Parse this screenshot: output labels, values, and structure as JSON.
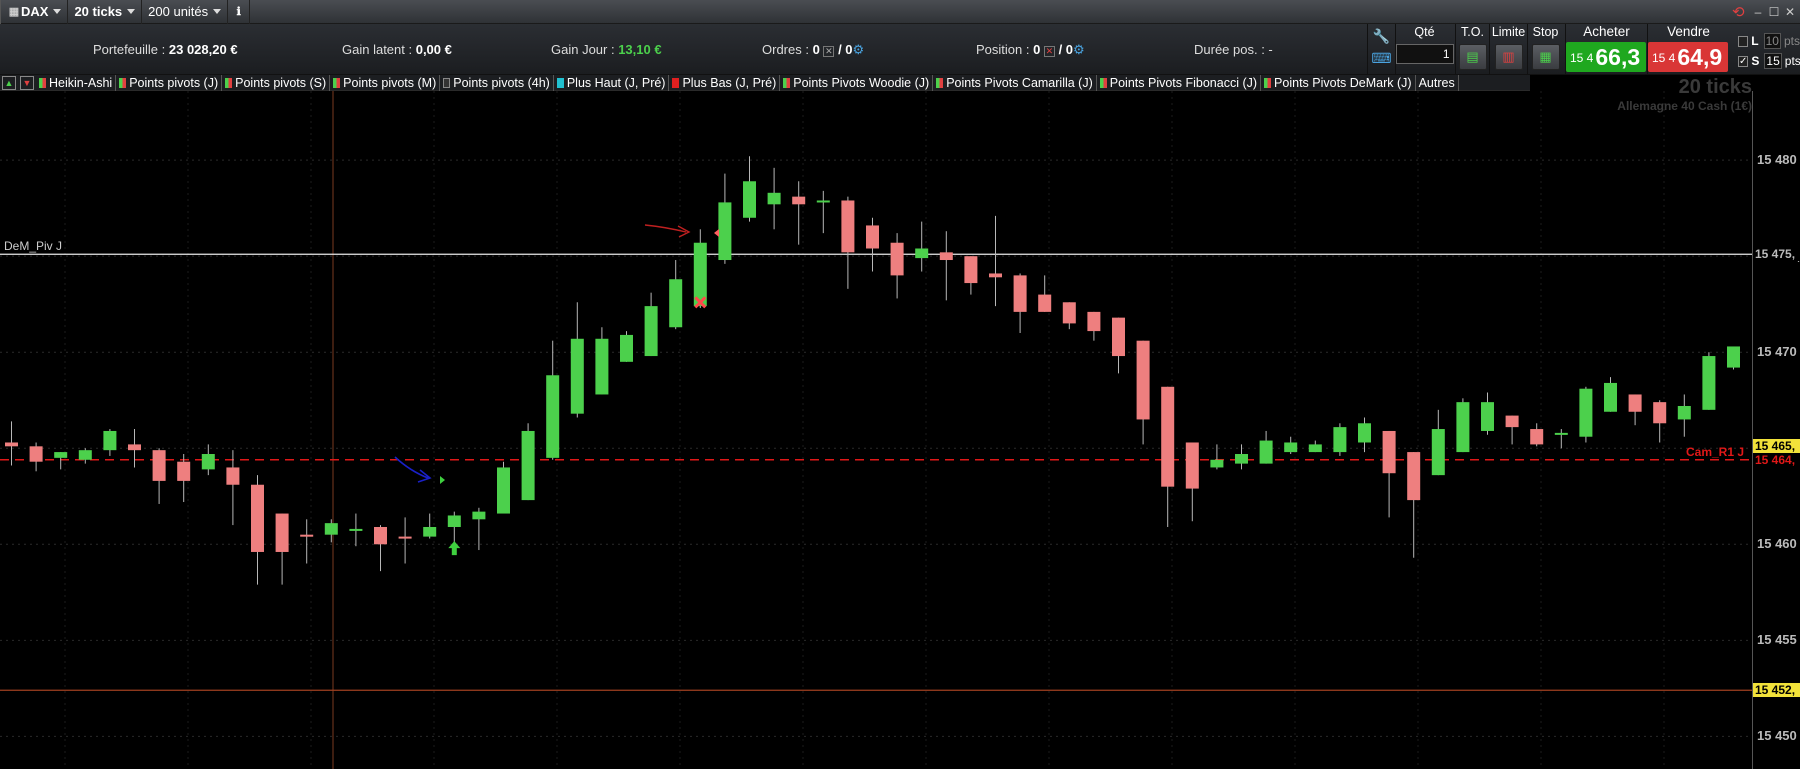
{
  "toolbar": {
    "instrument": "DAX",
    "interval": "20 ticks",
    "units": "200 unités"
  },
  "stats": {
    "portfolio_label": "Portefeuille : ",
    "portfolio_value": "23 028,20 €",
    "unrealized_label": "Gain latent : ",
    "unrealized_value": "0,00 €",
    "daygain_label": "Gain Jour : ",
    "daygain_value": "13,10 €",
    "orders_label": "Ordres : ",
    "orders_value": "0",
    "orders_value2": "/ 0",
    "position_label": "Position : ",
    "position_value": "0",
    "position_value2": "/ 0",
    "duration_label": "Durée pos. : -"
  },
  "order_panel": {
    "qty_label": "Qté",
    "qty_value": "1",
    "to_label": "T.O.",
    "limit_label": "Limite",
    "stop_label": "Stop",
    "buy_label": "Acheter",
    "sell_label": "Vendre",
    "buy_prefix": "15 4",
    "buy_price": "66,3",
    "sell_prefix": "15 4",
    "sell_price": "64,9",
    "side_l": "L",
    "side_s": "S",
    "side_val1": "10",
    "side_unit1": "pts",
    "side_val2": "15",
    "side_unit2": "pts",
    "buy_color": "#1fa81f",
    "sell_color": "#d93636"
  },
  "indicators": [
    {
      "label": "Heikin-Ashi",
      "colors": [
        "#4cd04c",
        "#e04040"
      ]
    },
    {
      "label": "Points pivots (J)",
      "colors": [
        "#4cd04c",
        "#e04040"
      ]
    },
    {
      "label": "Points pivots (S)",
      "colors": [
        "#4cd04c",
        "#e04040"
      ]
    },
    {
      "label": "Points pivots (M)",
      "colors": [
        "#4cd04c",
        "#e04040"
      ]
    },
    {
      "label": "Points pivots (4h)",
      "colors": [
        "#333333",
        "#333333"
      ]
    },
    {
      "label": "Plus Haut (J, Pré)",
      "colors": [
        "#20c0d0",
        "#20c0d0"
      ]
    },
    {
      "label": "Plus Bas (J, Pré)",
      "colors": [
        "#e02020",
        "#e02020"
      ]
    },
    {
      "label": "Points Pivots Woodie (J)",
      "colors": [
        "#4cd04c",
        "#e04040"
      ]
    },
    {
      "label": "Points Pivots Camarilla (J)",
      "colors": [
        "#4cd04c",
        "#e04040"
      ]
    },
    {
      "label": "Points Pivots Fibonacci (J)",
      "colors": [
        "#4cd04c",
        "#e04040"
      ]
    },
    {
      "label": "Points Pivots DeMark (J)",
      "colors": [
        "#4cd04c",
        "#e04040"
      ]
    },
    {
      "label": "Autres",
      "colors": []
    }
  ],
  "watermark": {
    "interval": "20 ticks",
    "instrument": "Allemagne 40 Cash (1€)"
  },
  "chart_data": {
    "type": "candlestick",
    "style": "Heikin-Ashi",
    "y_range": [
      15448.3,
      15483.6
    ],
    "y_ticks": [
      "15 480",
      "15 475,",
      "15 470",
      "15 465,",
      "15 460",
      "15 455",
      "15 450"
    ],
    "y_tick_values": [
      15480,
      15475,
      15470,
      15465,
      15460,
      15455,
      15450
    ],
    "colors": {
      "up": "#4cd04c",
      "down": "#ee7f7f",
      "grid": "#2a2a2a"
    },
    "candles": [
      {
        "o": 15465.3,
        "h": 15466.4,
        "l": 15464.1,
        "c": 15465.1
      },
      {
        "o": 15465.1,
        "h": 15465.3,
        "l": 15463.8,
        "c": 15464.3
      },
      {
        "o": 15464.5,
        "h": 15464.8,
        "l": 15463.9,
        "c": 15464.8
      },
      {
        "o": 15464.4,
        "h": 15465.0,
        "l": 15464.2,
        "c": 15464.9
      },
      {
        "o": 15464.9,
        "h": 15466.0,
        "l": 15464.6,
        "c": 15465.9
      },
      {
        "o": 15465.2,
        "h": 15466.0,
        "l": 15464.0,
        "c": 15464.9
      },
      {
        "o": 15464.9,
        "h": 15465.0,
        "l": 15462.1,
        "c": 15463.3
      },
      {
        "o": 15464.3,
        "h": 15464.7,
        "l": 15462.2,
        "c": 15463.3
      },
      {
        "o": 15463.9,
        "h": 15465.2,
        "l": 15463.6,
        "c": 15464.7
      },
      {
        "o": 15464.0,
        "h": 15464.9,
        "l": 15461.0,
        "c": 15463.1
      },
      {
        "o": 15463.1,
        "h": 15463.6,
        "l": 15457.9,
        "c": 15459.6
      },
      {
        "o": 15461.6,
        "h": 15461.6,
        "l": 15457.9,
        "c": 15459.6
      },
      {
        "o": 15460.5,
        "h": 15461.3,
        "l": 15459.0,
        "c": 15460.4
      },
      {
        "o": 15460.5,
        "h": 15461.3,
        "l": 15460.1,
        "c": 15461.1
      },
      {
        "o": 15460.8,
        "h": 15461.6,
        "l": 15459.9,
        "c": 15460.8
      },
      {
        "o": 15460.9,
        "h": 15461.0,
        "l": 15458.6,
        "c": 15460.0
      },
      {
        "o": 15460.4,
        "h": 15461.4,
        "l": 15459.0,
        "c": 15460.3
      },
      {
        "o": 15460.4,
        "h": 15461.6,
        "l": 15460.3,
        "c": 15460.9
      },
      {
        "o": 15460.9,
        "h": 15461.7,
        "l": 15459.8,
        "c": 15461.5
      },
      {
        "o": 15461.3,
        "h": 15461.9,
        "l": 15459.7,
        "c": 15461.7
      },
      {
        "o": 15461.6,
        "h": 15464.3,
        "l": 15461.6,
        "c": 15464.0
      },
      {
        "o": 15462.3,
        "h": 15466.3,
        "l": 15462.3,
        "c": 15465.9
      },
      {
        "o": 15464.5,
        "h": 15470.6,
        "l": 15464.4,
        "c": 15468.8
      },
      {
        "o": 15466.8,
        "h": 15472.6,
        "l": 15466.6,
        "c": 15470.7
      },
      {
        "o": 15467.8,
        "h": 15471.3,
        "l": 15467.8,
        "c": 15470.7
      },
      {
        "o": 15469.5,
        "h": 15471.1,
        "l": 15469.5,
        "c": 15470.9
      },
      {
        "o": 15469.8,
        "h": 15473.1,
        "l": 15469.8,
        "c": 15472.4
      },
      {
        "o": 15471.3,
        "h": 15474.8,
        "l": 15471.2,
        "c": 15473.8
      },
      {
        "o": 15472.4,
        "h": 15476.4,
        "l": 15472.3,
        "c": 15475.7
      },
      {
        "o": 15474.8,
        "h": 15479.3,
        "l": 15474.6,
        "c": 15477.8
      },
      {
        "o": 15477.0,
        "h": 15480.2,
        "l": 15476.8,
        "c": 15478.9
      },
      {
        "o": 15477.7,
        "h": 15479.6,
        "l": 15476.4,
        "c": 15478.3
      },
      {
        "o": 15478.1,
        "h": 15478.9,
        "l": 15475.6,
        "c": 15477.7
      },
      {
        "o": 15477.9,
        "h": 15478.4,
        "l": 15476.2,
        "c": 15477.9
      },
      {
        "o": 15477.9,
        "h": 15478.1,
        "l": 15473.3,
        "c": 15475.2
      },
      {
        "o": 15476.6,
        "h": 15477.0,
        "l": 15474.2,
        "c": 15475.4
      },
      {
        "o": 15475.7,
        "h": 15476.2,
        "l": 15472.8,
        "c": 15474.0
      },
      {
        "o": 15474.9,
        "h": 15476.8,
        "l": 15474.2,
        "c": 15475.4
      },
      {
        "o": 15475.2,
        "h": 15476.3,
        "l": 15472.7,
        "c": 15474.8
      },
      {
        "o": 15475.0,
        "h": 15475.0,
        "l": 15473.0,
        "c": 15473.6
      },
      {
        "o": 15474.1,
        "h": 15477.1,
        "l": 15472.4,
        "c": 15473.9
      },
      {
        "o": 15474.0,
        "h": 15474.1,
        "l": 15471.0,
        "c": 15472.1
      },
      {
        "o": 15473.0,
        "h": 15474.0,
        "l": 15472.1,
        "c": 15472.1
      },
      {
        "o": 15472.6,
        "h": 15472.6,
        "l": 15471.2,
        "c": 15471.5
      },
      {
        "o": 15472.1,
        "h": 15472.1,
        "l": 15470.6,
        "c": 15471.1
      },
      {
        "o": 15471.8,
        "h": 15471.8,
        "l": 15468.9,
        "c": 15469.8
      },
      {
        "o": 15470.6,
        "h": 15470.6,
        "l": 15465.2,
        "c": 15466.5
      },
      {
        "o": 15468.2,
        "h": 15468.2,
        "l": 15460.9,
        "c": 15463.0
      },
      {
        "o": 15465.3,
        "h": 15465.3,
        "l": 15461.2,
        "c": 15462.9
      },
      {
        "o": 15464.0,
        "h": 15465.2,
        "l": 15463.9,
        "c": 15464.4
      },
      {
        "o": 15464.2,
        "h": 15465.2,
        "l": 15463.9,
        "c": 15464.7
      },
      {
        "o": 15464.2,
        "h": 15465.9,
        "l": 15464.2,
        "c": 15465.4
      },
      {
        "o": 15464.8,
        "h": 15465.6,
        "l": 15464.7,
        "c": 15465.3
      },
      {
        "o": 15464.8,
        "h": 15465.4,
        "l": 15464.8,
        "c": 15465.2
      },
      {
        "o": 15464.8,
        "h": 15466.3,
        "l": 15464.6,
        "c": 15466.1
      },
      {
        "o": 15465.3,
        "h": 15466.6,
        "l": 15464.8,
        "c": 15466.3
      },
      {
        "o": 15465.9,
        "h": 15465.9,
        "l": 15461.4,
        "c": 15463.7
      },
      {
        "o": 15464.8,
        "h": 15464.8,
        "l": 15459.3,
        "c": 15462.3
      },
      {
        "o": 15463.6,
        "h": 15467.0,
        "l": 15463.6,
        "c": 15466.0
      },
      {
        "o": 15464.8,
        "h": 15467.6,
        "l": 15464.8,
        "c": 15467.4
      },
      {
        "o": 15465.9,
        "h": 15467.9,
        "l": 15465.7,
        "c": 15467.4
      },
      {
        "o": 15466.7,
        "h": 15466.7,
        "l": 15465.2,
        "c": 15466.1
      },
      {
        "o": 15466.0,
        "h": 15466.3,
        "l": 15465.1,
        "c": 15465.2
      },
      {
        "o": 15465.7,
        "h": 15466.0,
        "l": 15465.0,
        "c": 15465.8
      },
      {
        "o": 15465.6,
        "h": 15468.2,
        "l": 15465.3,
        "c": 15468.1
      },
      {
        "o": 15466.9,
        "h": 15468.7,
        "l": 15466.9,
        "c": 15468.4
      },
      {
        "o": 15467.8,
        "h": 15467.8,
        "l": 15466.2,
        "c": 15466.9
      },
      {
        "o": 15467.4,
        "h": 15467.5,
        "l": 15465.3,
        "c": 15466.3
      },
      {
        "o": 15466.5,
        "h": 15467.8,
        "l": 15465.6,
        "c": 15467.2
      },
      {
        "o": 15467.0,
        "h": 15470.0,
        "l": 15467.0,
        "c": 15469.8
      },
      {
        "o": 15469.2,
        "h": 15470.3,
        "l": 15469.1,
        "c": 15470.3
      }
    ],
    "horizontal_lines": [
      {
        "price": 15475.1,
        "label": "DeM_Piv J",
        "axis_label": "15 475,",
        "color": "#e8e8e8",
        "dashed": false
      },
      {
        "price": 15464.4,
        "label": "Cam_R1 J",
        "axis_label": "15 464,",
        "color": "#e01818",
        "dashed": true
      },
      {
        "price": 15465.1,
        "label": "",
        "axis_label": "15 465,",
        "color": "#f2e23a",
        "dashed": false
      },
      {
        "price": 15452.4,
        "label": "",
        "axis_label": "15 452,",
        "color": "#a04020",
        "dashed": false
      }
    ],
    "markers": [
      {
        "type": "buy-arrow",
        "candle": 18,
        "price": 15459.8,
        "color": "#3fd03f"
      },
      {
        "type": "sell-cross",
        "candle": 28,
        "price": 15472.6,
        "color": "#ff4a4a"
      }
    ]
  }
}
